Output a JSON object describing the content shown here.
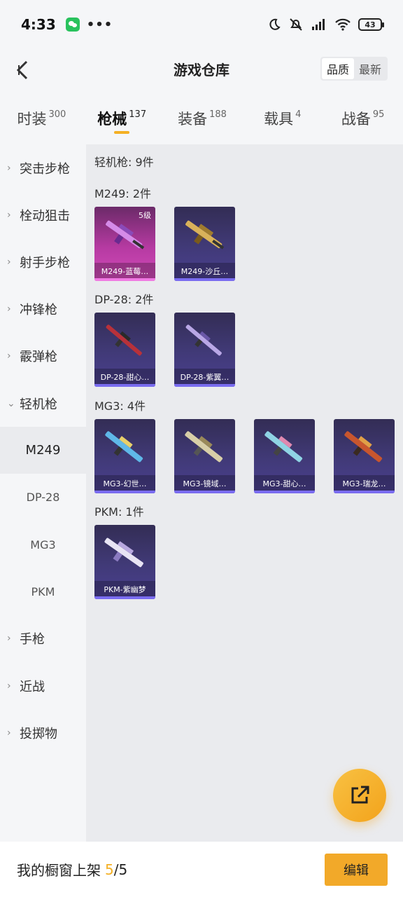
{
  "status_bar": {
    "time": "4:33",
    "dots": "•••",
    "battery": "43"
  },
  "header": {
    "title": "游戏仓库",
    "sort_options": [
      "品质",
      "最新"
    ]
  },
  "tabs": [
    {
      "label": "时装",
      "count": "300"
    },
    {
      "label": "枪械",
      "count": "137"
    },
    {
      "label": "装备",
      "count": "188"
    },
    {
      "label": "载具",
      "count": "4"
    },
    {
      "label": "战备",
      "count": "95"
    }
  ],
  "sidebar": {
    "items": [
      {
        "label": "突击步枪",
        "chevron": "›"
      },
      {
        "label": "栓动狙击",
        "chevron": "›"
      },
      {
        "label": "射手步枪",
        "chevron": "›"
      },
      {
        "label": "冲锋枪",
        "chevron": "›"
      },
      {
        "label": "霰弹枪",
        "chevron": "›"
      },
      {
        "label": "轻机枪",
        "chevron": "⌄"
      },
      {
        "label": "M249"
      },
      {
        "label": "DP-28"
      },
      {
        "label": "MG3"
      },
      {
        "label": "PKM"
      },
      {
        "label": "手枪",
        "chevron": "›"
      },
      {
        "label": "近战",
        "chevron": "›"
      },
      {
        "label": "投掷物",
        "chevron": "›"
      }
    ]
  },
  "content": {
    "total": "轻机枪: 9件",
    "groups": [
      {
        "title": "M249: 2件",
        "items": [
          {
            "name": "M249-蓝莓…",
            "level": "5级"
          },
          {
            "name": "M249-沙丘…"
          }
        ]
      },
      {
        "title": "DP-28: 2件",
        "items": [
          {
            "name": "DP-28-甜心…"
          },
          {
            "name": "DP-28-紫翼…"
          }
        ]
      },
      {
        "title": "MG3: 4件",
        "items": [
          {
            "name": "MG3-幻世…"
          },
          {
            "name": "MG3-镜域…"
          },
          {
            "name": "MG3-甜心…"
          },
          {
            "name": "MG3-瑞龙…"
          }
        ]
      },
      {
        "title": "PKM: 1件",
        "items": [
          {
            "name": "PKM-紫幽梦"
          }
        ]
      }
    ]
  },
  "bottom_bar": {
    "label": "我的橱窗上架",
    "current": "5",
    "total": "/5",
    "edit_label": "编辑"
  },
  "colors": {
    "accent": "#f4b024",
    "card_purple": "#413a78",
    "card_pink": "#b63aa2"
  }
}
